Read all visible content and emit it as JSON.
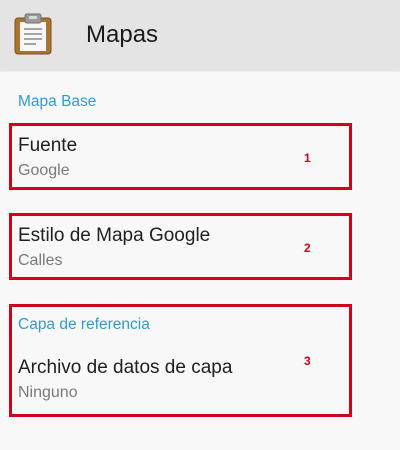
{
  "app_bar": {
    "title": "Mapas",
    "icon": "clipboard-icon"
  },
  "colors": {
    "accent": "#2f9ad6",
    "annotation": "#d0021b",
    "app_bar_bg": "#e4e4e4",
    "page_bg": "#f8f8f8"
  },
  "sections": [
    {
      "header": "Mapa Base",
      "items": [
        {
          "title": "Fuente",
          "summary": "Google"
        },
        {
          "title": "Estilo de Mapa Google",
          "summary": "Calles"
        }
      ]
    },
    {
      "header": "Capa de referencia",
      "items": [
        {
          "title": "Archivo de datos de capa",
          "summary": "Ninguno"
        }
      ]
    }
  ],
  "annotations": [
    "1",
    "2",
    "3"
  ]
}
